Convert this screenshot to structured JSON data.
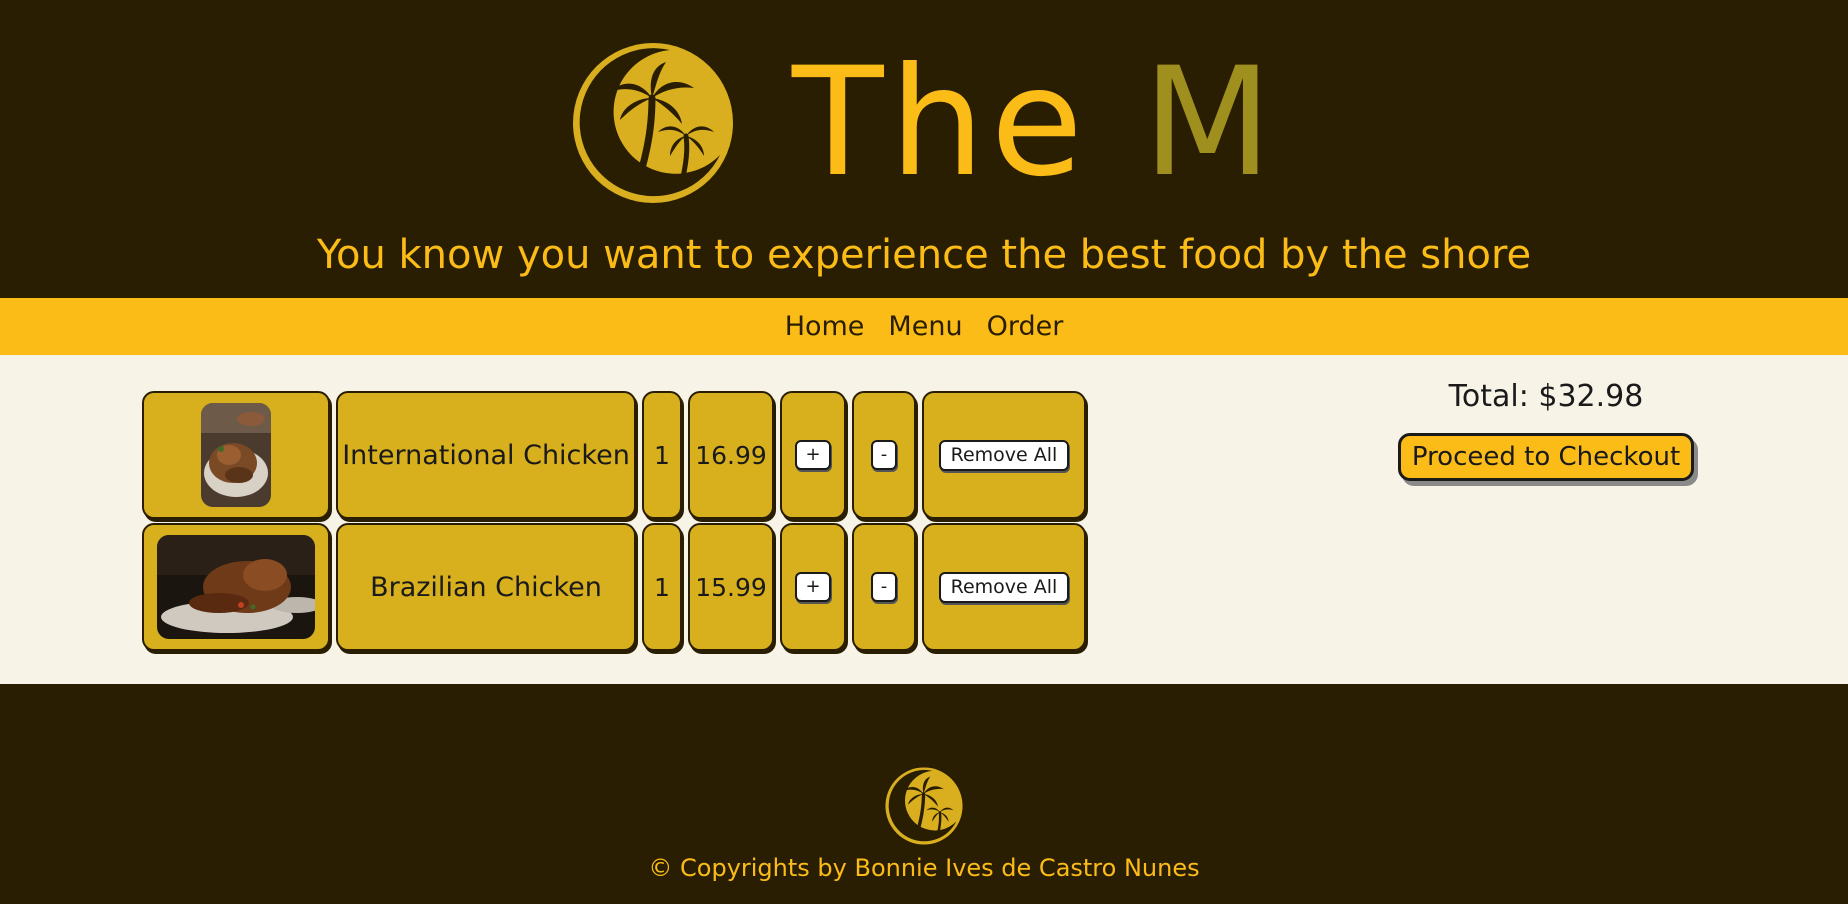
{
  "header": {
    "brand_part1": "The",
    "brand_part2": "M",
    "tagline": "You know you want to experience the best food by the shore"
  },
  "nav": {
    "items": [
      "Home",
      "Menu",
      "Order"
    ]
  },
  "cart": {
    "items": [
      {
        "name": "International Chicken",
        "quantity": "1",
        "price": "16.99",
        "image": "food-photo",
        "increment_label": "+",
        "decrement_label": "-",
        "remove_label": "Remove All"
      },
      {
        "name": "Brazilian Chicken",
        "quantity": "1",
        "price": "15.99",
        "image": "food-photo",
        "increment_label": "+",
        "decrement_label": "-",
        "remove_label": "Remove All"
      }
    ]
  },
  "summary": {
    "total": "Total: $32.98",
    "checkout_label": "Proceed to Checkout"
  },
  "footer": {
    "copyright": "© Copyrights by Bonnie Ives de Castro Nunes"
  },
  "colors": {
    "dark_brown": "#2a1e02",
    "yellow": "#fbbc17",
    "olive": "#9e8f1e",
    "cell_gold": "#d8b01e",
    "cream": "#f7f3e7"
  },
  "icons": {
    "logo": "palm-tree-logo-icon"
  }
}
